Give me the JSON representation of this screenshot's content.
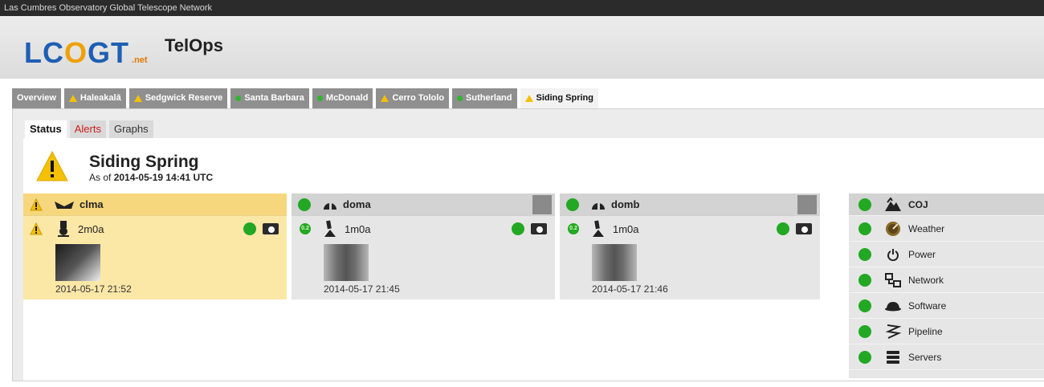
{
  "topbar": {
    "title": "Las Cumbres Observatory Global Telescope Network"
  },
  "header": {
    "logo_text": "LCOGT",
    "logo_suffix": ".net",
    "app_name": "TelOps"
  },
  "site_tabs": [
    {
      "label": "Overview",
      "status": "none"
    },
    {
      "label": "Haleakalā",
      "status": "warning"
    },
    {
      "label": "Sedgwick Reserve",
      "status": "warning"
    },
    {
      "label": "Santa Barbara",
      "status": "ok"
    },
    {
      "label": "McDonald",
      "status": "ok"
    },
    {
      "label": "Cerro Tololo",
      "status": "warning"
    },
    {
      "label": "Sutherland",
      "status": "ok"
    },
    {
      "label": "Siding Spring",
      "status": "warning",
      "active": true
    }
  ],
  "sub_tabs": [
    {
      "label": "Status",
      "active": true
    },
    {
      "label": "Alerts"
    },
    {
      "label": "Graphs"
    }
  ],
  "site": {
    "name": "Siding Spring",
    "as_of_prefix": "As of",
    "as_of_time": "2014-05-19 14:41 UTC"
  },
  "enclosures": [
    {
      "name": "clma",
      "status": "warning",
      "telescope": "2m0a",
      "telescope_status": "warning",
      "image_time": "2014-05-17 21:52"
    },
    {
      "name": "doma",
      "status": "ok",
      "telescope": "1m0a",
      "telescope_status": "ok",
      "image_time": "2014-05-17 21:45"
    },
    {
      "name": "domb",
      "status": "ok",
      "telescope": "1m0a",
      "telescope_status": "ok",
      "image_time": "2014-05-17 21:46"
    }
  ],
  "badge_text": "0.2",
  "services": {
    "header": "COJ",
    "items": [
      {
        "label": "Weather",
        "icon": "weather-icon"
      },
      {
        "label": "Power",
        "icon": "power-icon"
      },
      {
        "label": "Network",
        "icon": "network-icon"
      },
      {
        "label": "Software",
        "icon": "software-icon"
      },
      {
        "label": "Pipeline",
        "icon": "pipeline-icon"
      },
      {
        "label": "Servers",
        "icon": "servers-icon"
      }
    ]
  },
  "colors": {
    "warning_bg": "#fbe7a6",
    "ok_green": "#23a823",
    "alert_red": "#cc1b1b",
    "tab_gray": "#8f8f8f"
  }
}
